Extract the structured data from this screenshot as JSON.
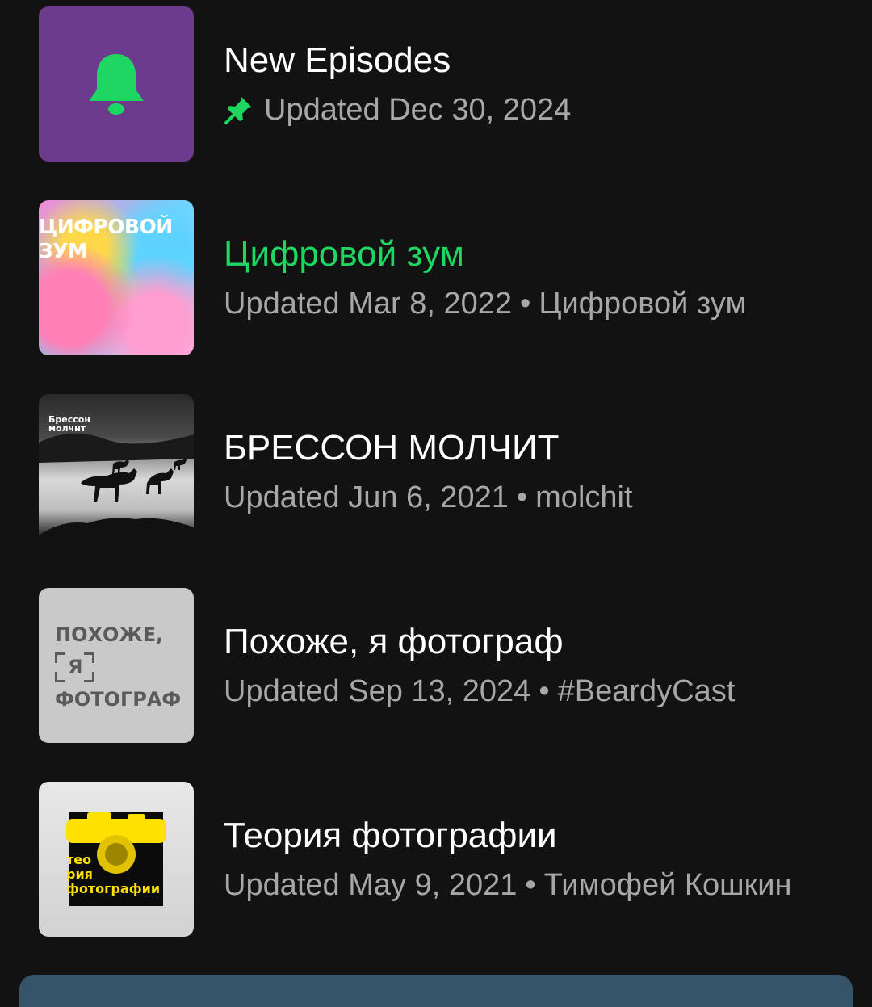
{
  "playlists": [
    {
      "title": "New Episodes",
      "subtitle": "Updated Dec 30, 2024",
      "owner": "",
      "pinned": true,
      "active": false,
      "cover_icon": "bell-icon",
      "cover_color": "#6d3b8d",
      "accent": "#1ed760"
    },
    {
      "title": "Цифровой зум",
      "subtitle": "Updated Mar 8, 2022",
      "owner": "Цифровой зум",
      "active": true,
      "cover_text": [
        "ЦИФРОВОЙ",
        "ЗУМ"
      ]
    },
    {
      "title": "БРЕССОН МОЛЧИТ",
      "subtitle": "Updated Jun 6, 2021",
      "owner": "molchit",
      "active": false,
      "cover_text": [
        "Брессон",
        "молчит"
      ]
    },
    {
      "title": "Похоже, я фотограф",
      "subtitle": "Updated Sep 13, 2024",
      "owner": "#BeardyCast",
      "active": false,
      "cover_text": [
        "ПОХОЖЕ,",
        "Я",
        "ФОТОГРАФ"
      ]
    },
    {
      "title": "Теория фотографии",
      "subtitle": "Updated May 9, 2021",
      "owner": "Тимофей Кошкин",
      "active": false,
      "cover_text": [
        "тео",
        "рия",
        "фотографии"
      ]
    }
  ],
  "separator": "•"
}
